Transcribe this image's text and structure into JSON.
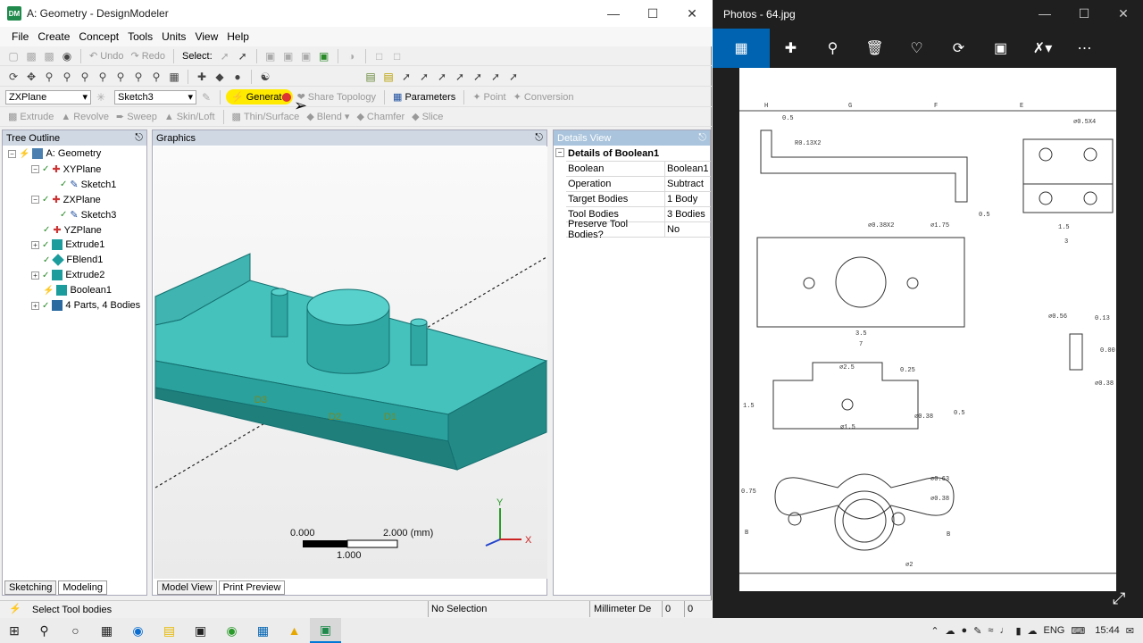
{
  "dm": {
    "title": "A: Geometry - DesignModeler",
    "app_icon": "DM",
    "menu": [
      "File",
      "Create",
      "Concept",
      "Tools",
      "Units",
      "View",
      "Help"
    ],
    "toolbar1": {
      "undo": "Undo",
      "redo": "Redo",
      "select": "Select:"
    },
    "toolbar3": {
      "plane": "ZXPlane",
      "sketch": "Sketch3",
      "generate": "Generate",
      "share": "Share Topology",
      "parameters": "Parameters",
      "point": "Point",
      "conversion": "Conversion"
    },
    "toolbar4": [
      "Extrude",
      "Revolve",
      "Sweep",
      "Skin/Loft",
      "Thin/Surface",
      "Blend",
      "Chamfer",
      "Slice"
    ],
    "tree": {
      "title": "Tree Outline",
      "items": [
        {
          "label": "A: Geometry"
        },
        {
          "label": "XYPlane"
        },
        {
          "label": "Sketch1"
        },
        {
          "label": "ZXPlane"
        },
        {
          "label": "Sketch3"
        },
        {
          "label": "YZPlane"
        },
        {
          "label": "Extrude1"
        },
        {
          "label": "FBlend1"
        },
        {
          "label": "Extrude2"
        },
        {
          "label": "Boolean1"
        },
        {
          "label": "4 Parts, 4 Bodies"
        }
      ],
      "tabs": [
        "Sketching",
        "Modeling"
      ]
    },
    "graphics": {
      "title": "Graphics",
      "labels": [
        "D3",
        "D2",
        "D1"
      ],
      "scale": {
        "left": "0.000",
        "right": "2.000 (mm)",
        "mid": "1.000"
      },
      "axes": {
        "y": "Y",
        "x": "X"
      },
      "tabs": [
        "Model View",
        "Print Preview"
      ]
    },
    "details": {
      "title": "Details View",
      "header": "Details of Boolean1",
      "rows": [
        {
          "k": "Boolean",
          "v": "Boolean1"
        },
        {
          "k": "Operation",
          "v": "Subtract"
        },
        {
          "k": "Target Bodies",
          "v": "1 Body"
        },
        {
          "k": "Tool Bodies",
          "v": "3 Bodies"
        },
        {
          "k": "Preserve Tool Bodies?",
          "v": "No"
        }
      ]
    },
    "status": {
      "msg": "Select Tool bodies",
      "sel": "No Selection",
      "unit": "Millimeter",
      "deg": "De",
      "v1": "0",
      "v2": "0"
    }
  },
  "photos": {
    "title": "Photos - 64.jpg"
  },
  "drawing": {
    "t1": "0.5",
    "t2": "R0.13X2",
    "t3": "0.5",
    "t4": "∅0.5X4",
    "t5": "1.5",
    "t6": "3",
    "t7": "∅0.38X2",
    "t8": "∅1.75",
    "t9": "3.5",
    "t10": "7",
    "t11": "∅2.5",
    "t12": "0.25",
    "t13": "∅0.38",
    "t14": "∅1.5",
    "t15": "0.5",
    "t16": "1.5",
    "t17": "∅0.56",
    "t18": "0.13",
    "t19": "0.00",
    "t20": "∅0.38",
    "t21": "∅0.63",
    "t22": "∅0.38",
    "t23": "0.75",
    "t24": "∅2",
    "t25": "B",
    "t26": "B",
    "borders": [
      "H",
      "G",
      "F",
      "E"
    ]
  },
  "taskbar": {
    "lang": "ENG",
    "time": "15:44"
  }
}
